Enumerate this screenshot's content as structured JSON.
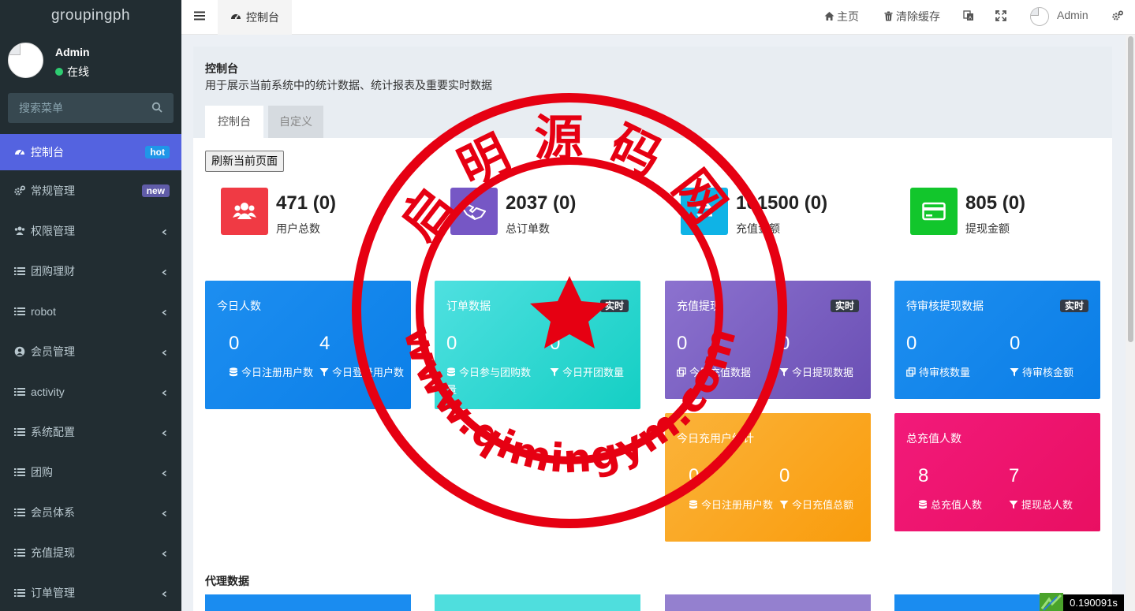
{
  "app": {
    "logo": "groupingph"
  },
  "user": {
    "name": "Admin",
    "status": "在线"
  },
  "search": {
    "placeholder": "搜索菜单"
  },
  "sidebar": {
    "items": [
      {
        "label": "控制台",
        "badge": "hot",
        "icon": "dashboard-icon",
        "active": true
      },
      {
        "label": "常规管理",
        "badge": "new",
        "icon": "cogs-icon"
      },
      {
        "label": "权限管理",
        "icon": "users-icon"
      },
      {
        "label": "团购理财",
        "icon": "list-icon"
      },
      {
        "label": "robot",
        "icon": "list-icon"
      },
      {
        "label": "会员管理",
        "icon": "user-circle-icon"
      },
      {
        "label": "activity",
        "icon": "list-icon"
      },
      {
        "label": "系统配置",
        "icon": "list-icon"
      },
      {
        "label": "团购",
        "icon": "list-icon"
      },
      {
        "label": "会员体系",
        "icon": "list-icon"
      },
      {
        "label": "充值提现",
        "icon": "list-icon"
      },
      {
        "label": "订单管理",
        "icon": "list-icon"
      }
    ]
  },
  "header": {
    "tab_label": "控制台",
    "home": "主页",
    "clear_cache": "清除缓存",
    "admin": "Admin"
  },
  "page": {
    "title": "控制台",
    "subtitle": "用于展示当前系统中的统计数据、统计报表及重要实时数据",
    "tabs": [
      "控制台",
      "自定义"
    ],
    "refresh": "刷新当前页面"
  },
  "stats": [
    {
      "value": "471 (0)",
      "label": "用户总数",
      "color": "#f03a44",
      "icon": "users-icon"
    },
    {
      "value": "2037 (0)",
      "label": "总订单数",
      "color": "#7657c5",
      "icon": "handshake-icon"
    },
    {
      "value": "101500 (0)",
      "label": "充值金额",
      "color": "#0fb3e6",
      "icon": "exchange-icon"
    },
    {
      "value": "805 (0)",
      "label": "提现金额",
      "color": "#12c62c",
      "icon": "credit-card-icon"
    }
  ],
  "cards": {
    "today": {
      "title": "今日人数",
      "v1": "0",
      "l1": "今日注册用户数",
      "v2": "4",
      "l2": "今日登录用户数"
    },
    "orders": {
      "title": "订单数据",
      "tag": "实时",
      "v1": "0",
      "l1": "今日参与团购数量",
      "v2": "0",
      "l2": "今日开团数量"
    },
    "recharge": {
      "title": "充值提现",
      "tag": "实时",
      "v1": "0",
      "l1": "今日充值数据",
      "v2": "0",
      "l2": "今日提现数据"
    },
    "pending": {
      "title": "待审核提现数据",
      "tag": "实时",
      "v1": "0",
      "l1": "待审核数量",
      "v2": "0",
      "l2": "待审核金额"
    },
    "firstcharge": {
      "title": "今日充用户统计",
      "v1": "0",
      "l1": "今日注册用户数",
      "v2": "0",
      "l2": "今日充值总额"
    },
    "total": {
      "title": "总充值人数",
      "v1": "8",
      "l1": "总充值人数",
      "v2": "7",
      "l2": "提现总人数"
    }
  },
  "agent": {
    "title": "代理数据"
  },
  "timer": "0.190091s",
  "watermark": {
    "top_text": "启明源码网",
    "bottom_text": "www.qimingym.com"
  },
  "colors": {
    "sidebar": "#222d32",
    "active": "#5463e0",
    "blue": "#1a8cf0",
    "teal": "#2fd6d0",
    "purple": "#7a5fc0",
    "orange": "#f9a51c",
    "pink": "#ee1670",
    "stamp": "#e60012"
  }
}
